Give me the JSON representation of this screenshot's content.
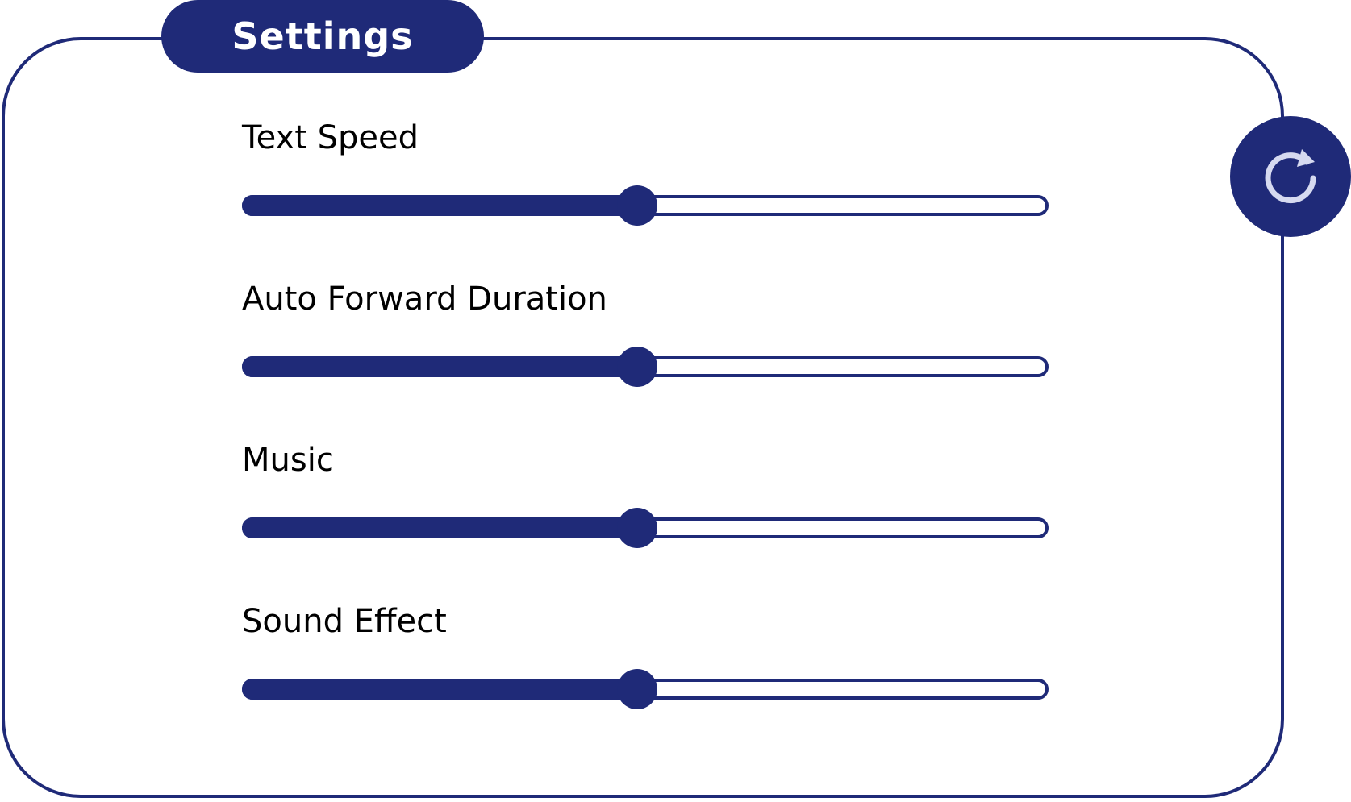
{
  "title": "Settings",
  "reset_button": {
    "icon": "reset-icon"
  },
  "settings": [
    {
      "id": "text-speed",
      "label": "Text Speed",
      "value": 0.49
    },
    {
      "id": "auto-forward-duration",
      "label": "Auto Forward Duration",
      "value": 0.49
    },
    {
      "id": "music",
      "label": "Music",
      "value": 0.49
    },
    {
      "id": "sound-effect",
      "label": "Sound Effect",
      "value": 0.49
    }
  ],
  "colors": {
    "accent": "#1f2a78",
    "background": "#ffffff",
    "icon": "#d6daf0"
  }
}
